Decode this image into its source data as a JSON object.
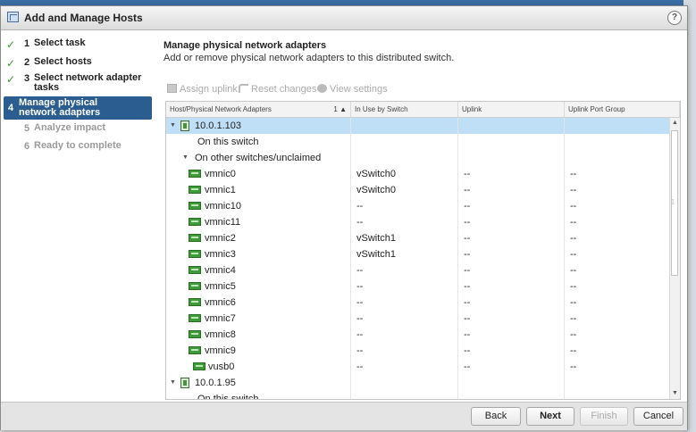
{
  "dialog": {
    "title": "Add and Manage Hosts",
    "help": "?"
  },
  "steps": [
    {
      "num": "1",
      "label": "Select task",
      "state": "done"
    },
    {
      "num": "2",
      "label": "Select hosts",
      "state": "done"
    },
    {
      "num": "3",
      "label": "Select network adapter tasks",
      "state": "done"
    },
    {
      "num": "4",
      "label": "Manage physical network adapters",
      "state": "active"
    },
    {
      "num": "5",
      "label": "Analyze impact",
      "state": "pending"
    },
    {
      "num": "6",
      "label": "Ready to complete",
      "state": "pending"
    }
  ],
  "main": {
    "heading": "Manage physical network adapters",
    "subheading": "Add or remove physical network adapters to this distributed switch."
  },
  "toolbar": {
    "assign_uplink": "Assign uplink",
    "reset_changes": "Reset changes",
    "view_settings": "View settings"
  },
  "grid": {
    "columns": [
      "Host/Physical Network Adapters",
      "In Use by Switch",
      "Uplink",
      "Uplink Port Group"
    ],
    "sort_indicator": "1 ▲",
    "rows": [
      {
        "type": "host",
        "name": "10.0.1.103",
        "in_use": "",
        "uplink": "",
        "port_group": "",
        "selected": true
      },
      {
        "type": "group-leaf",
        "name": "On this switch",
        "in_use": "",
        "uplink": "",
        "port_group": ""
      },
      {
        "type": "group",
        "name": "On other switches/unclaimed",
        "in_use": "",
        "uplink": "",
        "port_group": ""
      },
      {
        "type": "nic",
        "name": "vmnic0",
        "in_use": "vSwitch0",
        "uplink": "--",
        "port_group": "--"
      },
      {
        "type": "nic",
        "name": "vmnic1",
        "in_use": "vSwitch0",
        "uplink": "--",
        "port_group": "--"
      },
      {
        "type": "nic",
        "name": "vmnic10",
        "in_use": "--",
        "uplink": "--",
        "port_group": "--"
      },
      {
        "type": "nic",
        "name": "vmnic11",
        "in_use": "--",
        "uplink": "--",
        "port_group": "--"
      },
      {
        "type": "nic",
        "name": "vmnic2",
        "in_use": "vSwitch1",
        "uplink": "--",
        "port_group": "--"
      },
      {
        "type": "nic",
        "name": "vmnic3",
        "in_use": "vSwitch1",
        "uplink": "--",
        "port_group": "--"
      },
      {
        "type": "nic",
        "name": "vmnic4",
        "in_use": "--",
        "uplink": "--",
        "port_group": "--"
      },
      {
        "type": "nic",
        "name": "vmnic5",
        "in_use": "--",
        "uplink": "--",
        "port_group": "--"
      },
      {
        "type": "nic",
        "name": "vmnic6",
        "in_use": "--",
        "uplink": "--",
        "port_group": "--"
      },
      {
        "type": "nic",
        "name": "vmnic7",
        "in_use": "--",
        "uplink": "--",
        "port_group": "--"
      },
      {
        "type": "nic",
        "name": "vmnic8",
        "in_use": "--",
        "uplink": "--",
        "port_group": "--"
      },
      {
        "type": "nic",
        "name": "vmnic9",
        "in_use": "--",
        "uplink": "--",
        "port_group": "--"
      },
      {
        "type": "nic2",
        "name": "vusb0",
        "in_use": "--",
        "uplink": "--",
        "port_group": "--"
      },
      {
        "type": "host",
        "name": "10.0.1.95",
        "in_use": "",
        "uplink": "",
        "port_group": ""
      },
      {
        "type": "group-leaf",
        "name": "On this switch",
        "in_use": "",
        "uplink": "",
        "port_group": ""
      }
    ]
  },
  "footer": {
    "back": "Back",
    "next": "Next",
    "finish": "Finish",
    "cancel": "Cancel"
  }
}
